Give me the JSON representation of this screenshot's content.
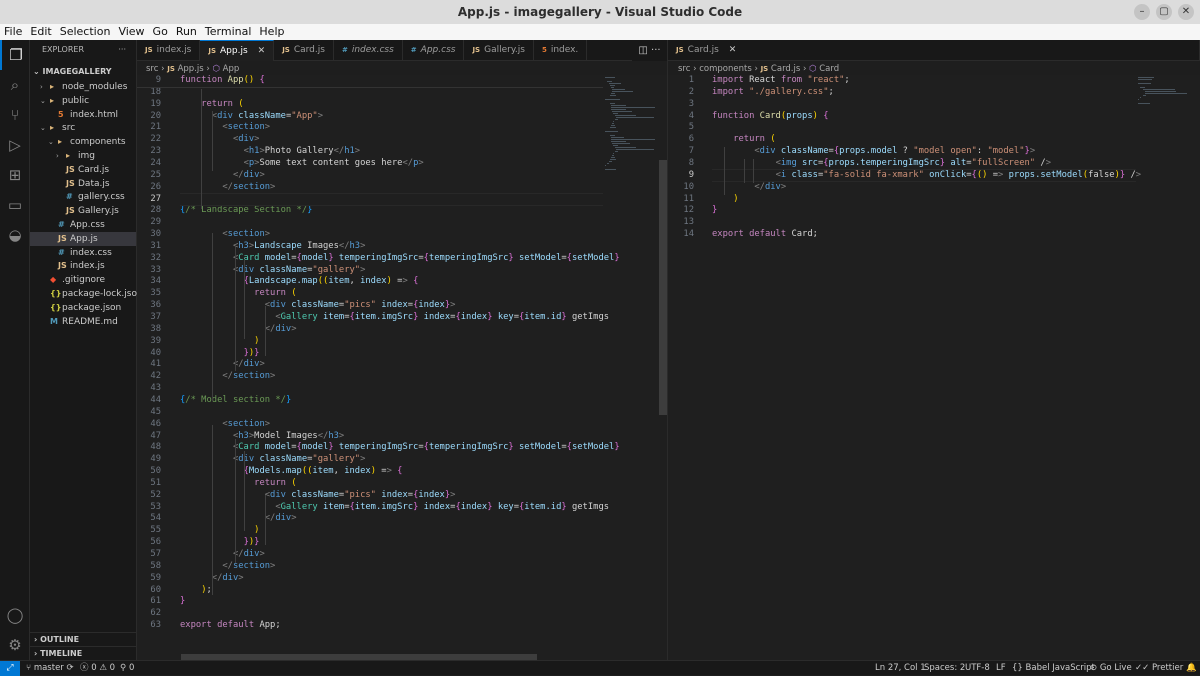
{
  "window": {
    "title": "App.js - imagegallery - Visual Studio Code"
  },
  "menu": [
    "File",
    "Edit",
    "Selection",
    "View",
    "Go",
    "Run",
    "Terminal",
    "Help"
  ],
  "sidebar": {
    "header": "EXPLORER",
    "root": "IMAGEGALLERY",
    "items": [
      {
        "label": "node_modules",
        "icon": "folder-icon"
      },
      {
        "label": "public",
        "icon": "folder-icon"
      },
      {
        "label": "index.html",
        "icon": "html-file-icon"
      },
      {
        "label": "src",
        "icon": "folder-icon"
      },
      {
        "label": "components",
        "icon": "folder-icon"
      },
      {
        "label": "img",
        "icon": "folder-icon"
      },
      {
        "label": "Card.js",
        "icon": "js-file-icon"
      },
      {
        "label": "Data.js",
        "icon": "js-file-icon"
      },
      {
        "label": "gallery.css",
        "icon": "css-file-icon"
      },
      {
        "label": "Gallery.js",
        "icon": "js-file-icon"
      },
      {
        "label": "App.css",
        "icon": "css-file-icon"
      },
      {
        "label": "App.js",
        "icon": "js-file-icon"
      },
      {
        "label": "index.css",
        "icon": "css-file-icon"
      },
      {
        "label": "index.js",
        "icon": "js-file-icon"
      },
      {
        "label": ".gitignore",
        "icon": "git-file-icon"
      },
      {
        "label": "package-lock.json",
        "icon": "json-file-icon"
      },
      {
        "label": "package.json",
        "icon": "json-file-icon"
      },
      {
        "label": "README.md",
        "icon": "markdown-file-icon"
      }
    ],
    "outline": "OUTLINE",
    "timeline": "TIMELINE"
  },
  "tabs_left": [
    {
      "label": "index.js",
      "type": "js"
    },
    {
      "label": "App.js",
      "type": "js",
      "active": true
    },
    {
      "label": "Card.js",
      "type": "js"
    },
    {
      "label": "index.css",
      "type": "css"
    },
    {
      "label": "App.css",
      "type": "css"
    },
    {
      "label": "Gallery.js",
      "type": "js"
    },
    {
      "label": "index.",
      "type": "html"
    }
  ],
  "tabs_right": [
    {
      "label": "Card.js",
      "type": "js"
    }
  ],
  "breadcrumb_left": {
    "a": "src",
    "b": "App.js",
    "c": "App"
  },
  "breadcrumb_right": {
    "a": "src",
    "b": "components",
    "c": "Card.js",
    "d": "Card"
  },
  "editor_left": {
    "lines": [
      {
        "n": "9",
        "code": "function App() {"
      },
      {
        "n": "18",
        "code": ""
      },
      {
        "n": "19",
        "code": "    return ("
      },
      {
        "n": "20",
        "code": "      <div className=\"App\">"
      },
      {
        "n": "21",
        "code": "        <section>"
      },
      {
        "n": "22",
        "code": "          <div>"
      },
      {
        "n": "23",
        "code": "            <h1>Photo Gallery</h1>"
      },
      {
        "n": "24",
        "code": "            <p>Some text content goes here</p>"
      },
      {
        "n": "25",
        "code": "          </div>"
      },
      {
        "n": "26",
        "code": "        </section>"
      },
      {
        "n": "27",
        "code": ""
      },
      {
        "n": "28",
        "code": "{/* Landscape Section */}"
      },
      {
        "n": "29",
        "code": ""
      },
      {
        "n": "30",
        "code": "        <section>"
      },
      {
        "n": "31",
        "code": "          <h3>Landscape Images</h3>"
      },
      {
        "n": "32",
        "code": "          <Card model={model} temperingImgSrc={temperingImgSrc} setModel={setModel}"
      },
      {
        "n": "33",
        "code": "          <div className=\"gallery\">"
      },
      {
        "n": "34",
        "code": "            {Landscape.map((item, index) => {"
      },
      {
        "n": "35",
        "code": "              return ("
      },
      {
        "n": "36",
        "code": "                <div className=\"pics\" index={index}>"
      },
      {
        "n": "37",
        "code": "                  <Gallery item={item.imgSrc} index={index} key={item.id} getImgs"
      },
      {
        "n": "38",
        "code": "                </div>"
      },
      {
        "n": "39",
        "code": "              )"
      },
      {
        "n": "40",
        "code": "            })}"
      },
      {
        "n": "41",
        "code": "          </div>"
      },
      {
        "n": "42",
        "code": "        </section>"
      },
      {
        "n": "43",
        "code": ""
      },
      {
        "n": "44",
        "code": "{/* Model section */}"
      },
      {
        "n": "45",
        "code": ""
      },
      {
        "n": "46",
        "code": "        <section>"
      },
      {
        "n": "47",
        "code": "          <h3>Model Images</h3>"
      },
      {
        "n": "48",
        "code": "          <Card model={model} temperingImgSrc={temperingImgSrc} setModel={setModel}"
      },
      {
        "n": "49",
        "code": "          <div className=\"gallery\">"
      },
      {
        "n": "50",
        "code": "            {Models.map((item, index) => {"
      },
      {
        "n": "51",
        "code": "              return ("
      },
      {
        "n": "52",
        "code": "                <div className=\"pics\" index={index}>"
      },
      {
        "n": "53",
        "code": "                  <Gallery item={item.imgSrc} index={index} key={item.id} getImgs"
      },
      {
        "n": "54",
        "code": "                </div>"
      },
      {
        "n": "55",
        "code": "              )"
      },
      {
        "n": "56",
        "code": "            })}"
      },
      {
        "n": "57",
        "code": "          </div>"
      },
      {
        "n": "58",
        "code": "        </section>"
      },
      {
        "n": "59",
        "code": "      </div>"
      },
      {
        "n": "60",
        "code": "    );"
      },
      {
        "n": "61",
        "code": "}"
      },
      {
        "n": "62",
        "code": ""
      },
      {
        "n": "63",
        "code": "export default App;"
      }
    ]
  },
  "editor_right": {
    "lines": [
      {
        "n": "1",
        "code": "import React from \"react\";"
      },
      {
        "n": "2",
        "code": "import \"./gallery.css\";"
      },
      {
        "n": "3",
        "code": ""
      },
      {
        "n": "4",
        "code": "function Card(props) {"
      },
      {
        "n": "5",
        "code": ""
      },
      {
        "n": "6",
        "code": "    return ("
      },
      {
        "n": "7",
        "code": "        <div className={props.model ? \"model open\": \"model\"}>"
      },
      {
        "n": "8",
        "code": "            <img src={props.temperingImgSrc} alt=\"fullScreen\" />"
      },
      {
        "n": "9",
        "code": "            <i class=\"fa-solid fa-xmark\" onClick={() => props.setModel(false)} />"
      },
      {
        "n": "10",
        "code": "        </div>"
      },
      {
        "n": "11",
        "code": "    )"
      },
      {
        "n": "12",
        "code": "}"
      },
      {
        "n": "13",
        "code": ""
      },
      {
        "n": "14",
        "code": "export default Card;"
      }
    ]
  },
  "status": {
    "branch": "master",
    "errors": "0",
    "warnings": "0",
    "ports": "0",
    "position": "Ln 27, Col 1",
    "spaces": "Spaces: 2",
    "encoding": "UTF-8",
    "eol": "LF",
    "language": "Babel JavaScript",
    "golive": "Go Live",
    "prettier": "Prettier"
  },
  "colors": {
    "accent": "#0078d4",
    "background": "#1f1f1f",
    "sidebar": "#181818"
  }
}
